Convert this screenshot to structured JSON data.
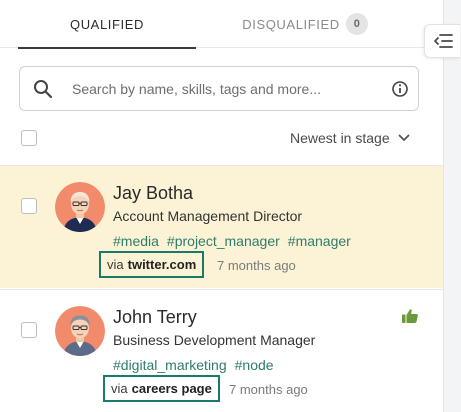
{
  "tabs": {
    "qualified_label": "QUALIFIED",
    "disqualified_label": "DISQUALIFIED",
    "disqualified_count": "0"
  },
  "search": {
    "placeholder": "Search by name, skills, tags and more..."
  },
  "sort": {
    "label": "Newest in stage"
  },
  "candidates": [
    {
      "name": "Jay Botha",
      "title": "Account Management Director",
      "tags": [
        "#media",
        "#project_manager",
        "#manager"
      ],
      "via": "via",
      "source": "twitter.com",
      "time": "7 months ago",
      "highlighted": true,
      "liked": false
    },
    {
      "name": "John Terry",
      "title": "Business Development Manager",
      "tags": [
        "#digital_marketing",
        "#node"
      ],
      "via": "via",
      "source": "careers page",
      "time": "7 months ago",
      "highlighted": false,
      "liked": true
    }
  ],
  "colors": {
    "highlight_row": "#fcf3d7",
    "tag_green": "#2e7d6b",
    "source_border": "#1a7a68",
    "thumb_green": "#6a9a3a"
  },
  "icons": {
    "search": "search-icon",
    "info": "info-icon",
    "sort_chevron": "chevron-down-icon",
    "collapse_panel": "collapse-panel-icon",
    "like": "thumbs-up-icon"
  }
}
